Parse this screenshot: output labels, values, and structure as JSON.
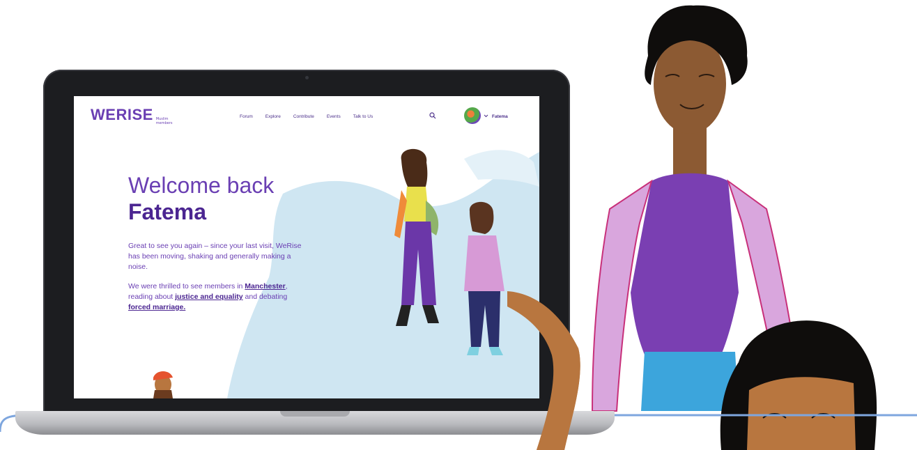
{
  "site": {
    "logo": "WERISE",
    "logo_sub": "Muslim members",
    "nav": [
      "Forum",
      "Explore",
      "Contribute",
      "Events",
      "Talk to Us"
    ],
    "user_name": "Fatema"
  },
  "hero": {
    "title_line1": "Welcome back",
    "title_line2": "Fatema",
    "paragraph1": "Great to see you again – since your last visit, WeRise has been moving, shaking and generally making a noise.",
    "p2_a": "We were thrilled to see members in ",
    "p2_link1": "Manchester",
    "p2_b": ", reading about ",
    "p2_link2": "justice and equality",
    "p2_c": " and debating ",
    "p2_link3": "forced marriage."
  },
  "colors": {
    "brand_purple": "#6a3fb3",
    "deep_purple": "#4b2591",
    "wash_blue": "#cfe6f2",
    "accent_blue": "#7ea6de"
  },
  "icons": [
    "search-icon",
    "chevron-down-icon"
  ]
}
